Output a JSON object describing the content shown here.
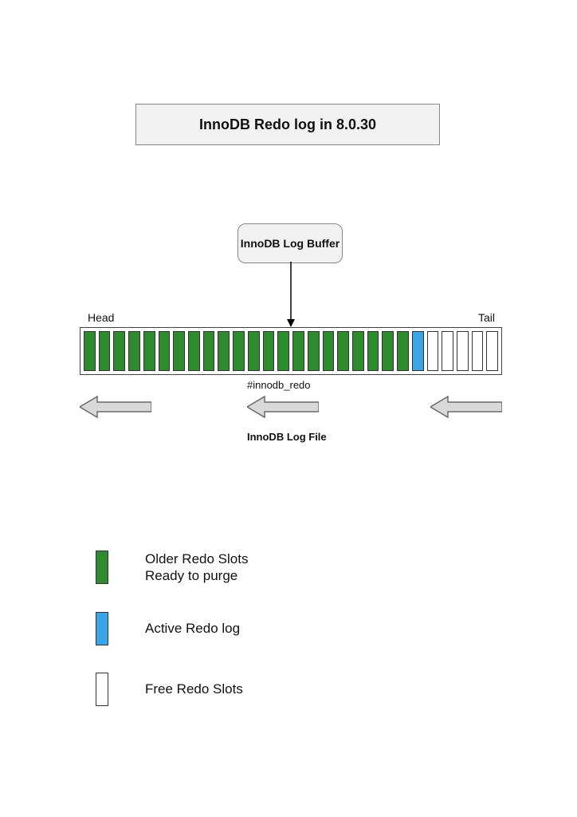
{
  "title": "InnoDB Redo log in 8.0.30",
  "buffer_label": "InnoDB Log Buffer",
  "head_label": "Head",
  "tail_label": "Tail",
  "innodb_redo_label": "#innodb_redo",
  "log_file_label": "InnoDB Log File",
  "slots": {
    "older_count": 22,
    "active_count": 1,
    "free_count": 5
  },
  "legend": {
    "older": "Older Redo Slots\nReady to purge",
    "active": "Active Redo log",
    "free": "Free Redo Slots"
  },
  "colors": {
    "older": "#2e8b2e",
    "active": "#3aa6e8",
    "free": "#ffffff"
  }
}
